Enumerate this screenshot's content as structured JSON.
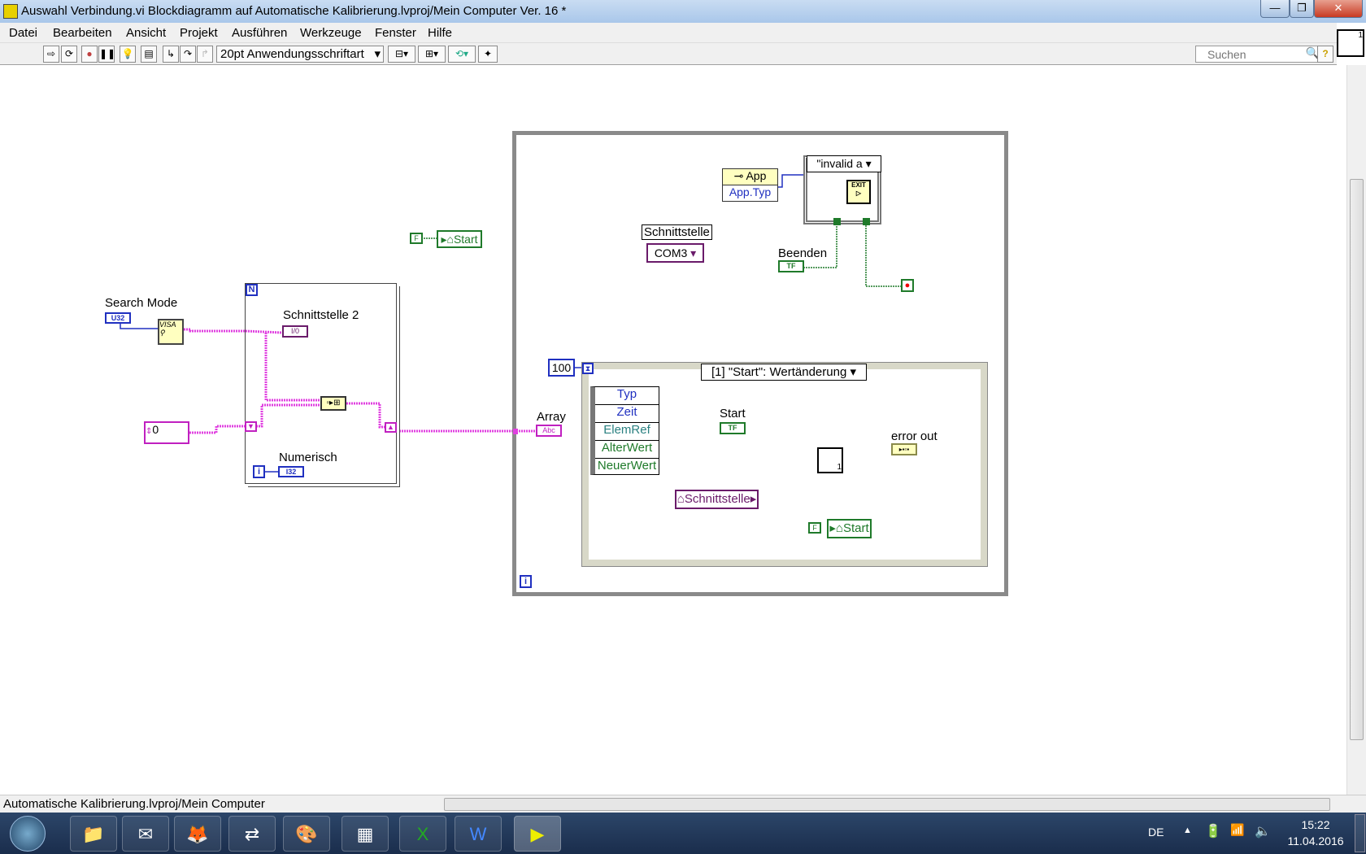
{
  "window": {
    "title": "Auswahl Verbindung.vi Blockdiagramm auf Automatische Kalibrierung.lvproj/Mein Computer Ver. 16 *",
    "minimize": "—",
    "restore": "❐",
    "close": "✕"
  },
  "menu": [
    "Datei",
    "Bearbeiten",
    "Ansicht",
    "Projekt",
    "Ausführen",
    "Werkzeuge",
    "Fenster",
    "Hilfe"
  ],
  "toolbar": {
    "font_select": "20pt Anwendungsschriftart",
    "search_placeholder": "Suchen",
    "help": "?"
  },
  "diagram": {
    "start_local_top": {
      "const": "F",
      "label": "Start"
    },
    "search_mode": {
      "label": "Search Mode",
      "type": "U32"
    },
    "visa_find": "VISA",
    "for_loop": {
      "count": "N",
      "iter": "i",
      "schnittstelle2_label": "Schnittstelle 2",
      "schnittstelle2_type": "I/0",
      "numerisch_label": "Numerisch",
      "numerisch_type": "I32"
    },
    "array_const": "0",
    "array_indicator": {
      "label": "Array",
      "type": "Abc"
    },
    "while_loop": {
      "iter": "i"
    },
    "schnittstelle": {
      "label": "Schnittstelle",
      "value": "COM3"
    },
    "app_property": {
      "class": "App",
      "property": "App.Typ"
    },
    "case_selector": "\"invalid a",
    "exit_label": "EXIT",
    "beenden": {
      "label": "Beenden",
      "type": "TF"
    },
    "timeout_const": "100",
    "event_selector": "[1] \"Start\": Wertänderung",
    "event_data": [
      "Typ",
      "Zeit",
      "ElemRef",
      "AlterWert",
      "NeuerWert"
    ],
    "start_control": {
      "label": "Start",
      "type": "TF"
    },
    "schnittstelle_local": "Schnittstelle",
    "subvi_num": "1",
    "error_out": {
      "label": "error out"
    },
    "start_local_bottom": {
      "const": "F",
      "label": "Start"
    }
  },
  "statusbar": {
    "context": "Automatische Kalibrierung.lvproj/Mein Computer"
  },
  "taskbar": {
    "apps": [
      "windows-explorer",
      "outlook",
      "firefox",
      "teamviewer",
      "paint",
      "calculator",
      "excel",
      "word",
      "labview"
    ],
    "lang": "DE",
    "time": "15:22",
    "date": "11.04.2016"
  },
  "colors": {
    "string_wire": "#e040e0",
    "bool_wire": "#1f7a2a",
    "int_wire": "#2030c0",
    "refnum_wire": "#6a1b6a",
    "error_wire": "#b0a000"
  }
}
